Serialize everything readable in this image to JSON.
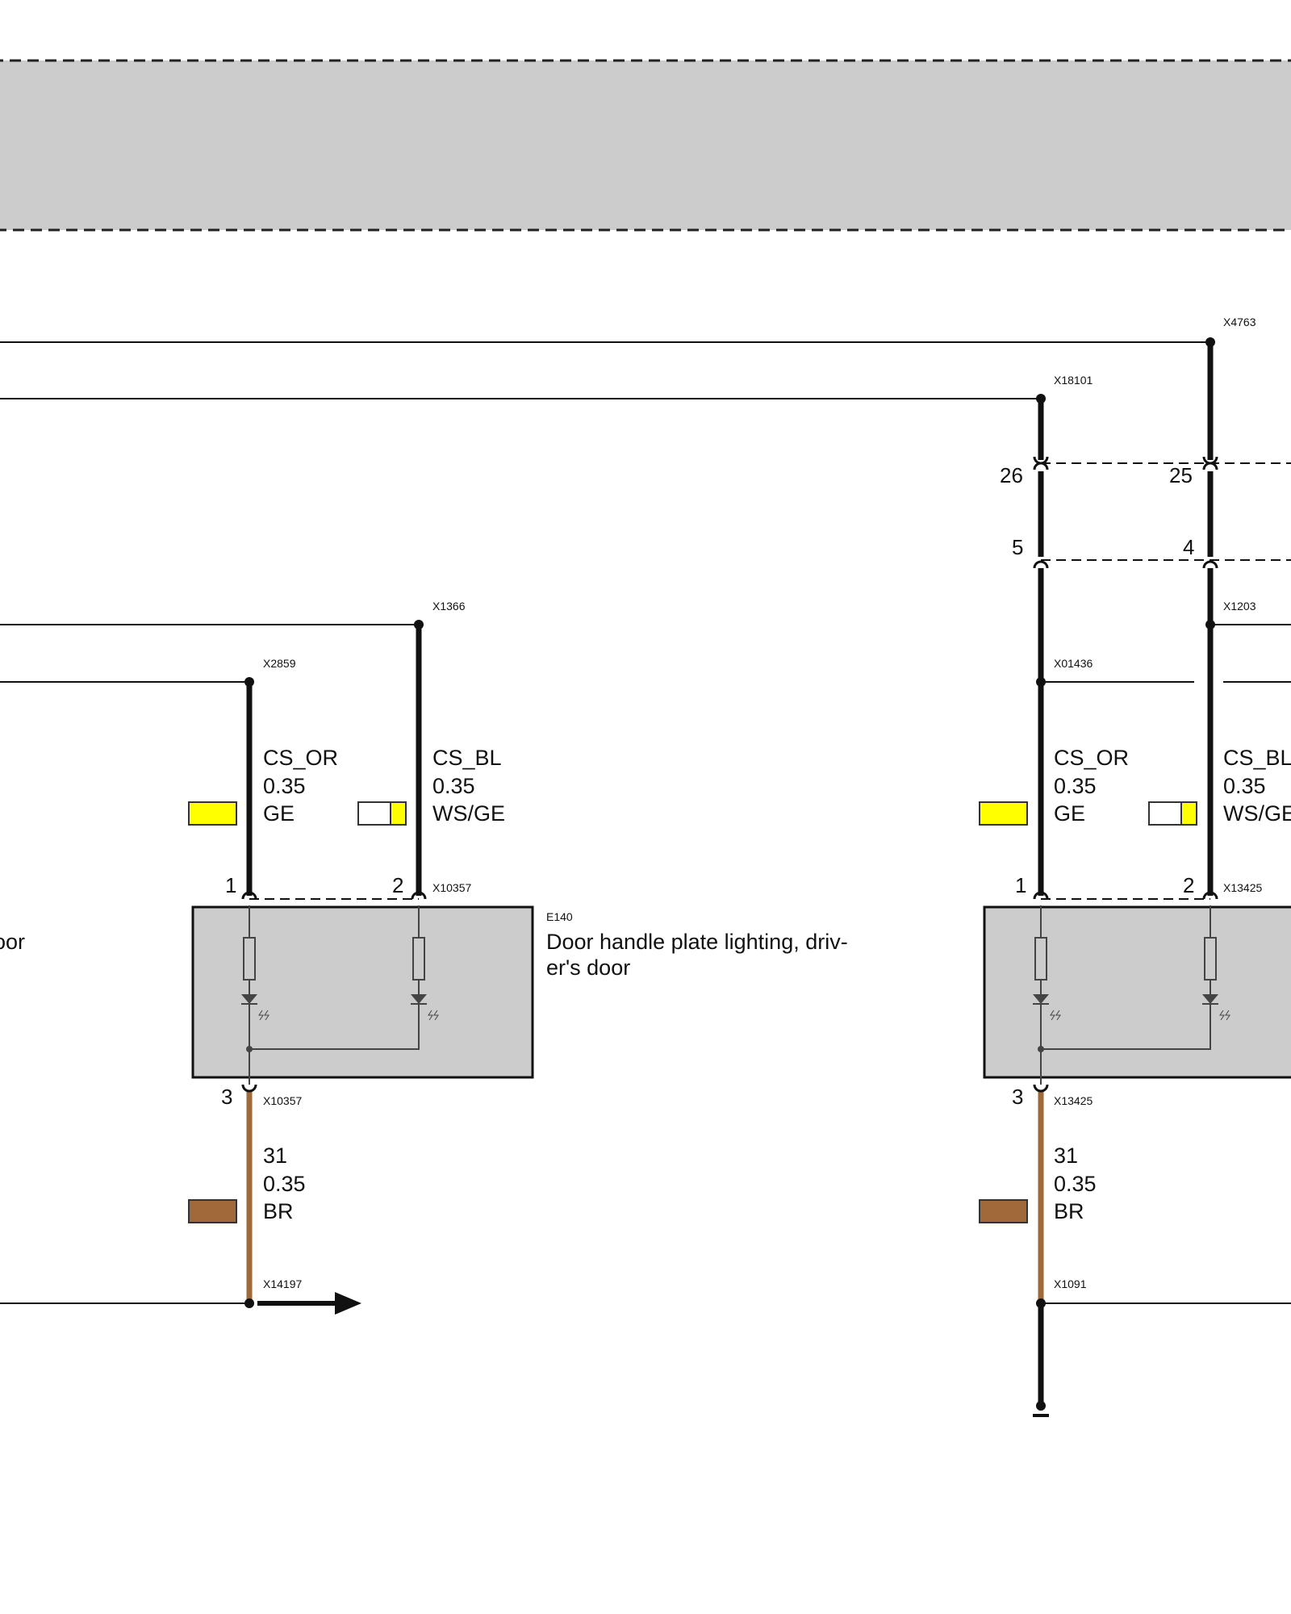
{
  "connectors_top": {
    "x4763": "X4763",
    "x18101": "X18101",
    "x1366": "X1366",
    "x2859": "X2859",
    "x1203": "X1203",
    "x01436": "X01436"
  },
  "splice_pins": {
    "row1_left": "26",
    "row1_right": "25",
    "row2_left": "5",
    "row2_right": "4"
  },
  "left_module": {
    "pin1": "1",
    "pin2": "2",
    "pin3": "3",
    "conn_top": "X10357",
    "conn_bottom": "X10357",
    "ref": "E140",
    "name_line1": "Door handle plate lighting, driv-",
    "name_line2": "er's door",
    "partial_label": "oor",
    "ground_conn": "X14197"
  },
  "right_module": {
    "pin1": "1",
    "pin2": "2",
    "pin3": "3",
    "conn_top": "X13425",
    "conn_bottom": "X13425",
    "ground_conn": "X1091"
  },
  "wires": {
    "left_or": {
      "signal": "CS_OR",
      "gauge": "0.35",
      "color": "GE"
    },
    "left_bl": {
      "signal": "CS_BL",
      "gauge": "0.35",
      "color": "WS/GE"
    },
    "left_gnd": {
      "signal": "31",
      "gauge": "0.35",
      "color": "BR"
    },
    "right_or": {
      "signal": "CS_OR",
      "gauge": "0.35",
      "color": "GE"
    },
    "right_bl": {
      "signal": "CS_BL",
      "gauge": "0.35",
      "color": "WS/GE"
    },
    "right_gnd": {
      "signal": "31",
      "gauge": "0.35",
      "color": "BR"
    }
  },
  "colors": {
    "yellow": "#ffff00",
    "brown": "#a0693a",
    "module_fill": "#cccccc",
    "banner_fill": "#cccccc"
  }
}
